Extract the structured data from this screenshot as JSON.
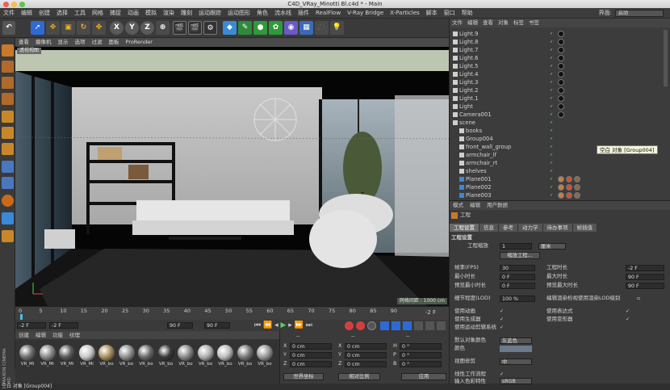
{
  "window": {
    "title": "C4D_VRay_Minotti Bl.c4d * - Main"
  },
  "menubar": {
    "items": [
      "文件",
      "编辑",
      "创建",
      "选择",
      "工具",
      "网格",
      "捕捉",
      "动画",
      "模拟",
      "渲染",
      "雕刻",
      "运动跟踪",
      "运动图形",
      "角色",
      "流水线",
      "插件",
      "RealFlow",
      "V-Ray Bridge",
      "X-Particles",
      "脚本",
      "窗口",
      "帮助"
    ],
    "layout_label": "界面:",
    "layout_value": "启动"
  },
  "toolbar": {
    "axis_x": "X",
    "axis_y": "Y",
    "axis_z": "Z"
  },
  "viewport": {
    "menu": [
      "查看",
      "摄像机",
      "显示",
      "选项",
      "过滤",
      "面板",
      "ProRender"
    ],
    "label": "透视视图",
    "grid_spacing": "网格间距 : 1000 cm"
  },
  "timeline": {
    "ticks": [
      "0",
      "5",
      "10",
      "15",
      "20",
      "25",
      "30",
      "35",
      "40",
      "45",
      "50",
      "55",
      "60",
      "65",
      "70",
      "75",
      "80",
      "85",
      "90"
    ],
    "end_frame": "-2 F",
    "start_field": "-2 F",
    "current_field": "-2 F",
    "max_field": "90 F",
    "end_field": "90 F"
  },
  "materials": {
    "menu": [
      "创建",
      "编辑",
      "功能",
      "纹理"
    ],
    "items": [
      {
        "name": "VR_Mi",
        "color": "#707070"
      },
      {
        "name": "VR_Mi",
        "color": "#8a8a8a"
      },
      {
        "name": "VR_Mi",
        "color": "#5a5a5a"
      },
      {
        "name": "VR_Mi",
        "color": "#c8c8c8"
      },
      {
        "name": "VR_bo",
        "color": "#a89060"
      },
      {
        "name": "VR_bo",
        "color": "#909090"
      },
      {
        "name": "VR_bo",
        "color": "#6a6a6a"
      },
      {
        "name": "VR_bo",
        "color": "#3a3a3a"
      },
      {
        "name": "VR_bo",
        "color": "#8a8a8a"
      },
      {
        "name": "VR_bo",
        "color": "#b0b0b0"
      },
      {
        "name": "VR_bo",
        "color": "#bdbdbd"
      },
      {
        "name": "VR_bo",
        "color": "#7a7a7a"
      },
      {
        "name": "VR_bo",
        "color": "#999999"
      }
    ],
    "brand": "MAXON CINEMA 4D"
  },
  "coords": {
    "header": [
      "--",
      "--",
      "--"
    ],
    "rows": [
      {
        "a": "X",
        "av": "0 cm",
        "b": "X",
        "bv": "0 cm",
        "c": "H",
        "cv": "0 °"
      },
      {
        "a": "Y",
        "av": "0 cm",
        "b": "Y",
        "bv": "0 cm",
        "c": "P",
        "cv": "0 °"
      },
      {
        "a": "Z",
        "av": "0 cm",
        "b": "Z",
        "bv": "0 cm",
        "c": "B",
        "cv": "0 °"
      }
    ],
    "mode_select": "世界坐标",
    "scale_select": "相对比例",
    "apply": "应用"
  },
  "objects": {
    "menu": [
      "文件",
      "编辑",
      "查看",
      "对象",
      "标签",
      "书签"
    ],
    "rows": [
      {
        "name": "Light.9",
        "indent": 0,
        "tags": 1
      },
      {
        "name": "Light.8",
        "indent": 0,
        "tags": 1
      },
      {
        "name": "Light.7",
        "indent": 0,
        "tags": 1
      },
      {
        "name": "Light.6",
        "indent": 0,
        "tags": 1
      },
      {
        "name": "Light.5",
        "indent": 0,
        "tags": 1
      },
      {
        "name": "Light.4",
        "indent": 0,
        "tags": 1
      },
      {
        "name": "Light.3",
        "indent": 0,
        "tags": 1
      },
      {
        "name": "Light.2",
        "indent": 0,
        "tags": 1
      },
      {
        "name": "Light.1",
        "indent": 0,
        "tags": 1
      },
      {
        "name": "Light",
        "indent": 0,
        "tags": 1
      },
      {
        "name": "Camera001",
        "indent": 0,
        "tags": 1
      },
      {
        "name": "scene",
        "indent": 0,
        "tags": 0
      },
      {
        "name": "books",
        "indent": 1,
        "tags": 0
      },
      {
        "name": "Group004",
        "indent": 1,
        "tags": 0
      },
      {
        "name": "front_wall_group",
        "indent": 1,
        "tags": 0
      },
      {
        "name": "armchair_lf",
        "indent": 1,
        "tags": 0
      },
      {
        "name": "armchair_rt",
        "indent": 1,
        "tags": 0
      },
      {
        "name": "shelves",
        "indent": 1,
        "tags": 0
      },
      {
        "name": "Plane001",
        "indent": 1,
        "tags": 3
      },
      {
        "name": "Plane002",
        "indent": 1,
        "tags": 3
      },
      {
        "name": "Plane003",
        "indent": 1,
        "tags": 3
      }
    ],
    "tooltip": "空白 对象 [Group004]"
  },
  "attributes": {
    "menu": [
      "模式",
      "编辑",
      "用户数据"
    ],
    "section": "工程",
    "tabs": [
      "工程设置",
      "信息",
      "参考",
      "动力学",
      "待办事项",
      "帧插值"
    ],
    "group": "工程设置",
    "project_scale_label": "工程缩放",
    "project_scale_value": "1",
    "project_scale_unit": "厘米",
    "scale_project_btn": "缩放工程...",
    "fps_label": "帧率(FPS)",
    "fps_value": "30",
    "project_len_label": "工程时长",
    "project_len_value": "-2 F",
    "min_time_label": "最小时长",
    "min_time_value": "0 F",
    "max_time_label": "最大时长",
    "max_time_value": "90 F",
    "preview_min_label": "预览最小时长",
    "preview_min_value": "0 F",
    "preview_max_label": "预览最大时长",
    "preview_max_value": "90 F",
    "lod_label": "细节程度(LOD)",
    "lod_value": "100 %",
    "lod_render_label": "编辑渲染检视使用渲染LOD级别",
    "use_anim_label": "使用动画",
    "use_expr_label": "使用表达式",
    "use_gen_label": "使用生成器",
    "use_deform_label": "使用变形器",
    "use_mograph_label": "使用运动剪辑系统",
    "default_color_label": "默认对象颜色",
    "default_color_value": "灰蓝色",
    "color_label": "颜色",
    "view_clip_label": "视图修剪",
    "view_clip_value": "中",
    "linear_workflow_label": "线性工作流程",
    "input_color_label": "输入色彩特性",
    "input_color_value": "sRGB"
  },
  "statusbar": {
    "text": "空白 对象 [Group004]"
  }
}
